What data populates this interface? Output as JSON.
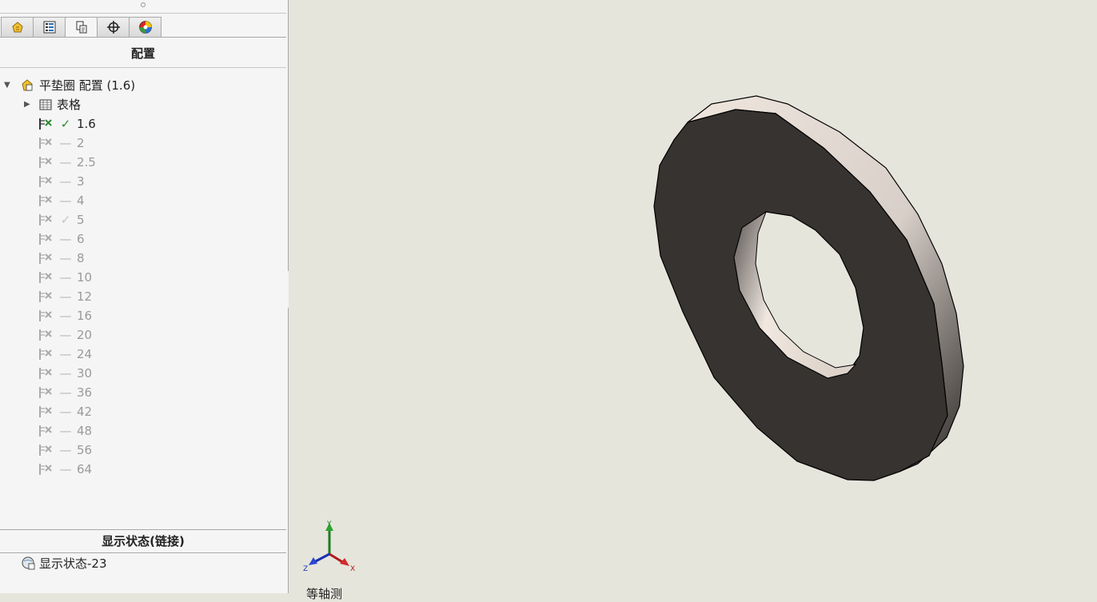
{
  "panel": {
    "tabs": [
      {
        "name": "feature-manager",
        "icon": "feature-manager-icon"
      },
      {
        "name": "property-manager",
        "icon": "property-manager-icon"
      },
      {
        "name": "configuration-manager",
        "icon": "configuration-manager-icon",
        "active": true
      },
      {
        "name": "dimxpert-manager",
        "icon": "dimxpert-icon"
      },
      {
        "name": "display-manager",
        "icon": "display-manager-icon"
      }
    ],
    "title": "配置"
  },
  "tree": {
    "root_label": "平垫圈 配置  (1.6)",
    "table_label": "表格",
    "configs": [
      {
        "label": "1.6",
        "status": "check-active",
        "active": true
      },
      {
        "label": "2",
        "status": "dash"
      },
      {
        "label": "2.5",
        "status": "dash"
      },
      {
        "label": "3",
        "status": "dash"
      },
      {
        "label": "4",
        "status": "dash"
      },
      {
        "label": "5",
        "status": "check-dim"
      },
      {
        "label": "6",
        "status": "dash"
      },
      {
        "label": "8",
        "status": "dash"
      },
      {
        "label": "10",
        "status": "dash"
      },
      {
        "label": "12",
        "status": "dash"
      },
      {
        "label": "16",
        "status": "dash"
      },
      {
        "label": "20",
        "status": "dash"
      },
      {
        "label": "24",
        "status": "dash"
      },
      {
        "label": "30",
        "status": "dash"
      },
      {
        "label": "36",
        "status": "dash"
      },
      {
        "label": "42",
        "status": "dash"
      },
      {
        "label": "48",
        "status": "dash"
      },
      {
        "label": "56",
        "status": "dash"
      },
      {
        "label": "64",
        "status": "dash"
      }
    ],
    "status_glyphs": {
      "check-active": "✓",
      "check-dim": "✓",
      "dash": "—"
    }
  },
  "display_states": {
    "header": "显示状态(链接)",
    "items": [
      "显示状态-23"
    ]
  },
  "viewport": {
    "triad": {
      "x": "X",
      "y": "Y",
      "z": "Z"
    },
    "bottom_text": "等轴测"
  },
  "colors": {
    "face_dark": "#363330",
    "edge_light": "#eee5dd",
    "background": "#e6e5dc",
    "check_green": "#2e8b2e"
  }
}
